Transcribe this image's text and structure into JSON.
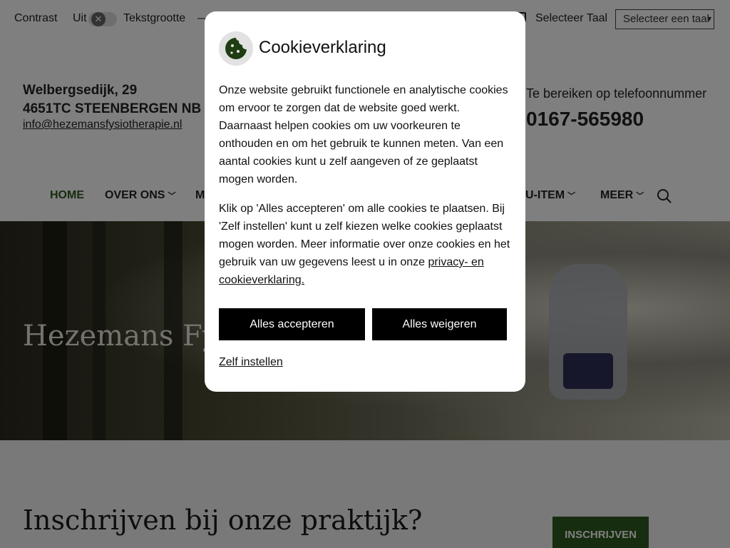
{
  "topbar": {
    "contrast_label": "Contrast",
    "contrast_value": "Uit",
    "toggle_symbol": "✕",
    "textsize_label": "Tekstgrootte",
    "textsize_glyph": "—",
    "language_label": "Selecteer Taal",
    "language_select": "Selecteer een taal"
  },
  "header": {
    "address_line1": "Welbergsedijk, 29",
    "address_line2": "4651TC STEENBERGEN NB",
    "email": "info@hezemansfysiotherapie.nl",
    "phone_label": "Te bereiken op telefoonnummer",
    "phone": "0167-565980"
  },
  "nav": {
    "items": [
      {
        "label": "HOME"
      },
      {
        "label": "OVER ONS"
      },
      {
        "label": "M"
      },
      {
        "label": "U-ITEM"
      },
      {
        "label": "MEER"
      }
    ]
  },
  "hero": {
    "title": "Hezemans Fys"
  },
  "content": {
    "title": "Inschrijven bij onze praktijk?",
    "enroll_button": "INSCHRIJVEN"
  },
  "cookie_modal": {
    "title": "Cookieverklaring",
    "paragraph1": "Onze website gebruikt functionele en analytische cookies om ervoor te zorgen dat de website goed werkt. Daarnaast helpen cookies om uw voorkeuren te onthouden en om het gebruik te kunnen meten. Van een aantal cookies kunt u zelf aangeven of ze geplaatst mogen worden.",
    "paragraph2_text": "Klik op 'Alles accepteren' om alle cookies te plaatsen. Bij 'Zelf instellen' kunt u zelf kiezen welke cookies geplaatst mogen worden. Meer informatie over onze cookies en het gebruik van uw gegevens leest u in onze ",
    "paragraph2_link": "privacy- en cookieverklaring.",
    "accept_button": "Alles accepteren",
    "refuse_button": "Alles weigeren",
    "settings_link": "Zelf instellen"
  },
  "colors": {
    "accent_green": "#2f5a1e",
    "button_black": "#000000",
    "overlay": "rgba(0,0,0,0.5)"
  }
}
